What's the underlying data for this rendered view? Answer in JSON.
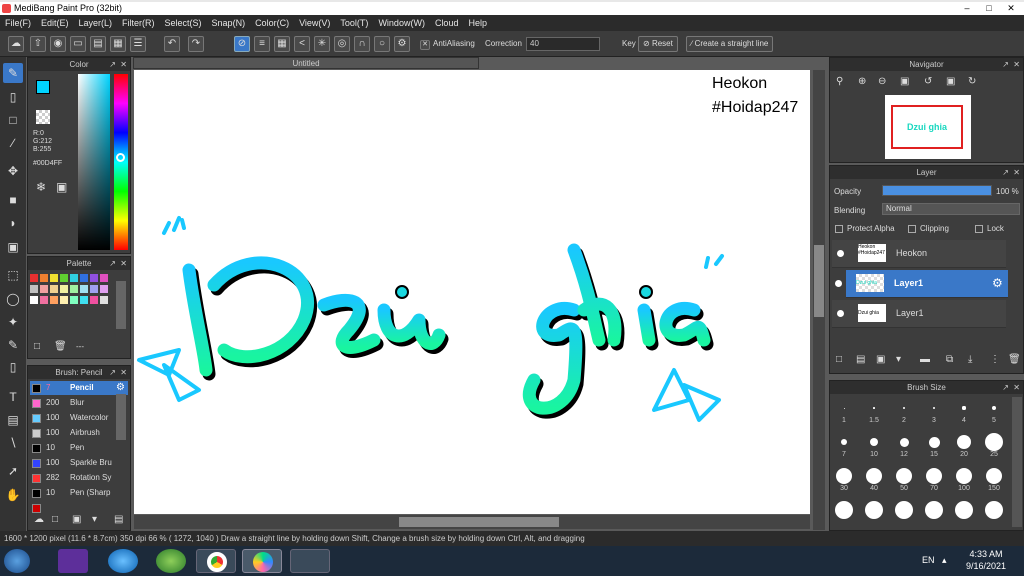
{
  "window": {
    "title": "MediBang Paint Pro (32bit)"
  },
  "menu": [
    "File(F)",
    "Edit(E)",
    "Layer(L)",
    "Filter(R)",
    "Select(S)",
    "Snap(N)",
    "Color(C)",
    "View(V)",
    "Tool(T)",
    "Window(W)",
    "Cloud",
    "Help"
  ],
  "toolbar": {
    "antialiasing_label": "AntiAliasing",
    "correction_label": "Correction",
    "correction_value": "40",
    "key_label": "Key",
    "reset_label": "Reset",
    "straight_line_label": "Create a straight line"
  },
  "color_panel": {
    "title": "Color",
    "r": "R:0",
    "g": "G:212",
    "b": "B:255",
    "hex": "#00D4FF",
    "accent": "#00d4ff"
  },
  "palette_panel": {
    "title": "Palette",
    "dots": "---"
  },
  "brush_panel": {
    "title": "Brush: Pencil",
    "items": [
      {
        "size": "7",
        "name": "Pencil",
        "color": "#000000"
      },
      {
        "size": "200",
        "name": "Blur",
        "color": "#ff66cc"
      },
      {
        "size": "100",
        "name": "Watercolor",
        "color": "#66ccff"
      },
      {
        "size": "100",
        "name": "Airbrush",
        "color": "#cccccc"
      },
      {
        "size": "10",
        "name": "Pen",
        "color": "#000000"
      },
      {
        "size": "100",
        "name": "Sparkle Bru",
        "color": "#3344ff"
      },
      {
        "size": "282",
        "name": "Rotation Sy",
        "color": "#ff3333"
      },
      {
        "size": "10",
        "name": "Pen (Sharp",
        "color": "#000000"
      },
      {
        "size": "",
        "name": "",
        "color": "#cc0000"
      }
    ]
  },
  "document": {
    "tab_title": "Untitled",
    "watermark_line1": "Heokon",
    "watermark_line2": "#Hoidap247"
  },
  "navigator": {
    "title": "Navigator"
  },
  "layer_panel": {
    "title": "Layer",
    "opacity_label": "Opacity",
    "opacity_value": "100 %",
    "opacity_fraction": 1.0,
    "blending_label": "Blending",
    "blending_value": "Normal",
    "protect_alpha": "Protect Alpha",
    "clipping": "Clipping",
    "lock": "Lock",
    "layers": [
      {
        "name": "Heokon",
        "thumb": "Heokon #Hoidap247"
      },
      {
        "name": "Layer1",
        "thumb": "Dzui ghia"
      },
      {
        "name": "Layer1",
        "thumb": "Dzui ghia"
      }
    ]
  },
  "brush_size_panel": {
    "title": "Brush Size",
    "sizes": [
      "1",
      "1.5",
      "2",
      "3",
      "4",
      "5",
      "7",
      "10",
      "12",
      "15",
      "20",
      "25",
      "30",
      "40",
      "50",
      "70",
      "100",
      "150",
      "",
      "",
      "",
      "",
      "",
      ""
    ]
  },
  "status": {
    "text": "1600 * 1200 pixel   (11.6 * 8.7cm)   350 dpi   66 %   ( 1272, 1040 )   Draw a straight line by holding down Shift, Change a brush size by holding down Ctrl, Alt, and dragging"
  },
  "taskbar": {
    "lang": "EN",
    "time": "4:33 AM",
    "date": "9/16/2021"
  }
}
